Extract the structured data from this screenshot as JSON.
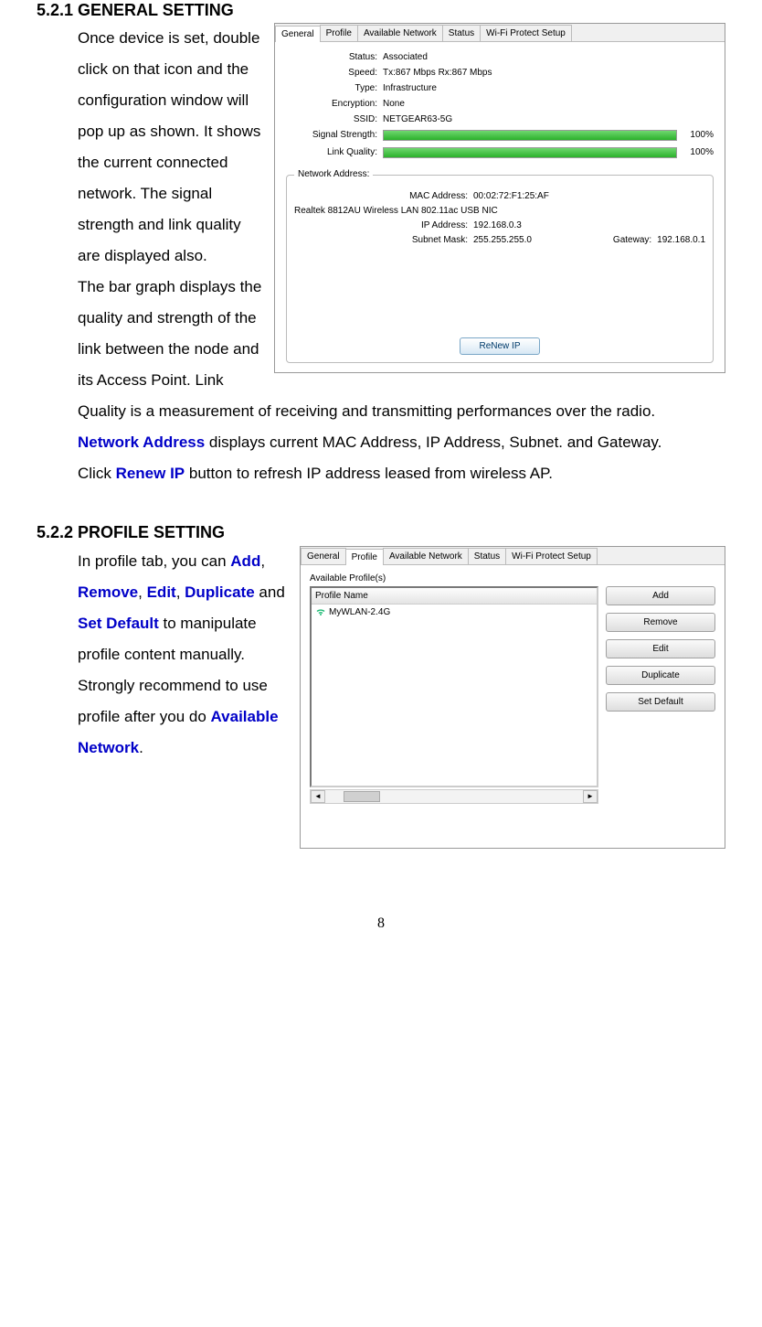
{
  "s1": {
    "heading": "5.2.1 GENERAL SETTING",
    "p1": "Once device is set, double click on that icon and the configuration window will pop up as shown. It shows the current connected network. The signal strength and link quality are displayed also.",
    "p2": "The bar graph displays the quality and strength of the link between the node and its Access Point. Link Quality is a measurement of receiving and transmitting performances over the radio.",
    "p3a": "Network Address",
    "p3b": " displays current MAC Address, IP Address, Subnet. and Gateway.",
    "p4a": "Click ",
    "p4b": "Renew IP",
    "p4c": " button to refresh IP address leased from wireless AP."
  },
  "s2": {
    "heading": "5.2.2 PROFILE SETTING",
    "t1": "In profile tab, you can ",
    "b1": "Add",
    "c1": ", ",
    "b2": "Remove",
    "c2": ", ",
    "b3": "Edit",
    "c3": ", ",
    "b4": "Duplicate",
    "c4": " and ",
    "b5": "Set Default",
    "t2": " to manipulate profile content manually. Strongly recommend to use profile after you do ",
    "b6": "Available Network",
    "c5": "."
  },
  "fig1": {
    "tabs": [
      "General",
      "Profile",
      "Available Network",
      "Status",
      "Wi-Fi Protect Setup"
    ],
    "k_status": "Status:",
    "v_status": "Associated",
    "k_speed": "Speed:",
    "v_speed": "Tx:867 Mbps Rx:867 Mbps",
    "k_type": "Type:",
    "v_type": "Infrastructure",
    "k_enc": "Encryption:",
    "v_enc": "None",
    "k_ssid": "SSID:",
    "v_ssid": "NETGEAR63-5G",
    "k_sig": "Signal Strength:",
    "p_sig": "100%",
    "k_lq": "Link Quality:",
    "p_lq": "100%",
    "box_title": "Network Address:",
    "k_mac": "MAC Address:",
    "v_mac": "00:02:72:F1:25:AF",
    "k_nic": "Realtek 8812AU Wireless LAN 802.11ac USB NIC",
    "k_ip": "IP Address:",
    "v_ip": "192.168.0.3",
    "k_sm": "Subnet Mask:",
    "v_sm": "255.255.255.0",
    "k_gw": "Gateway:",
    "v_gw": "192.168.0.1",
    "btn_renew": "ReNew IP"
  },
  "fig2": {
    "tabs": [
      "General",
      "Profile",
      "Available Network",
      "Status",
      "Wi-Fi Protect Setup"
    ],
    "avail": "Available Profile(s)",
    "col_head": "Profile Name",
    "item": "MyWLAN-2.4G",
    "btn_add": "Add",
    "btn_remove": "Remove",
    "btn_edit": "Edit",
    "btn_dup": "Duplicate",
    "btn_def": "Set Default",
    "arrow_l": "◄",
    "arrow_r": "►"
  },
  "page_num": "8",
  "chart_data": {
    "type": "bar",
    "series": [
      {
        "name": "Signal Strength",
        "values": [
          100
        ]
      },
      {
        "name": "Link Quality",
        "values": [
          100
        ]
      }
    ],
    "xlabel": "",
    "ylabel": "%",
    "ylim": [
      0,
      100
    ]
  }
}
